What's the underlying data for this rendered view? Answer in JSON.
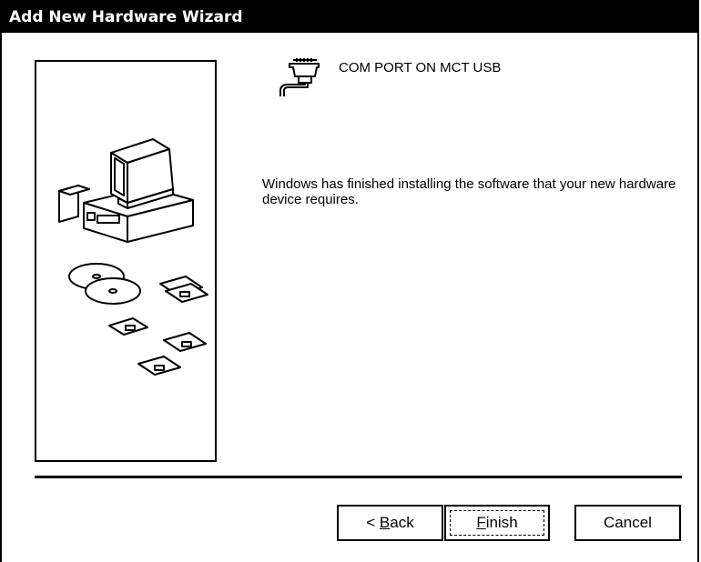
{
  "window": {
    "title": "Add New Hardware Wizard"
  },
  "device": {
    "icon": "serial-port-icon",
    "name": "COM PORT ON MCT USB"
  },
  "message": "Windows has finished installing the software that your new hardware device requires.",
  "illustration": {
    "icons": [
      "computer-icon",
      "cd-icon",
      "floppy-disk-icon"
    ]
  },
  "buttons": {
    "back": {
      "prefix": "< ",
      "mnemonic": "B",
      "rest": "ack"
    },
    "finish": {
      "prefix": "",
      "mnemonic": "F",
      "rest": "inish",
      "focused": true
    },
    "cancel": {
      "label": "Cancel"
    }
  }
}
